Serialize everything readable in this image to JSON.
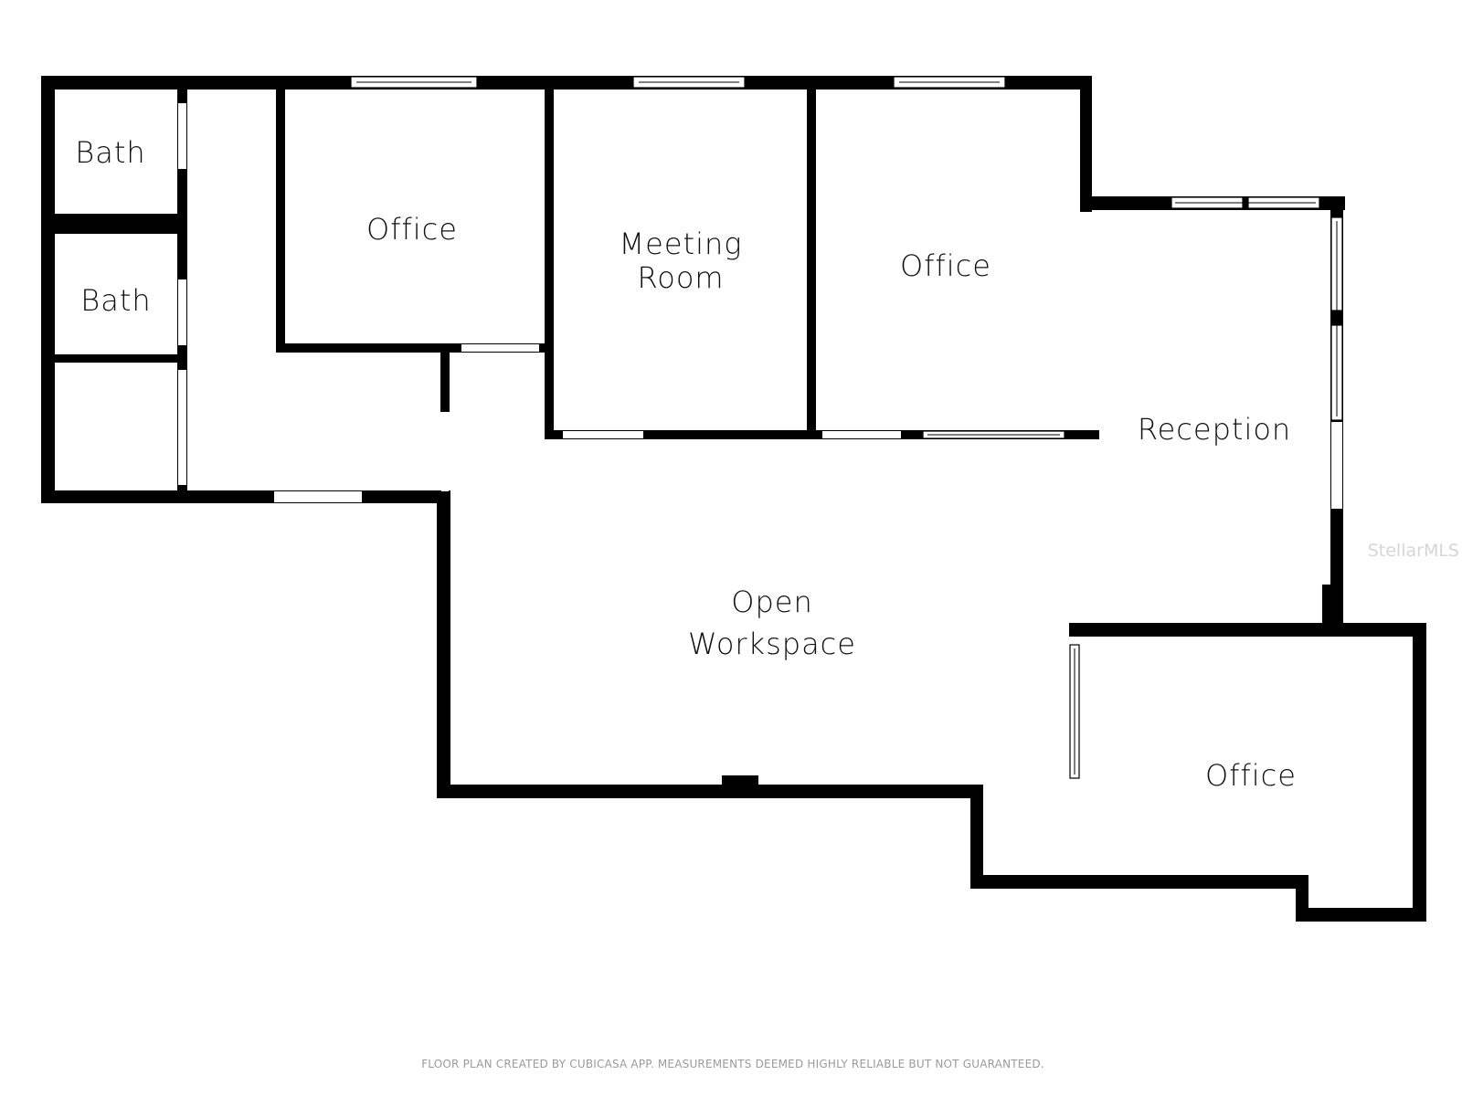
{
  "rooms": {
    "bath_1": "Bath",
    "bath_2": "Bath",
    "office_1": "Office",
    "meeting_line1": "Meeting",
    "meeting_line2": "Room",
    "office_2": "Office",
    "reception": "Reception",
    "open_line1": "Open",
    "open_line2": "Workspace",
    "office_3": "Office"
  },
  "watermark": "StellarMLS",
  "footer": "FLOOR PLAN CREATED BY CUBICASA APP. MEASUREMENTS DEEMED HIGHLY RELIABLE BUT NOT GUARANTEED.",
  "colors": {
    "wall": "#000000",
    "background": "#ffffff",
    "footer_text": "#9a9a9a",
    "watermark": "#d6d6d6"
  }
}
